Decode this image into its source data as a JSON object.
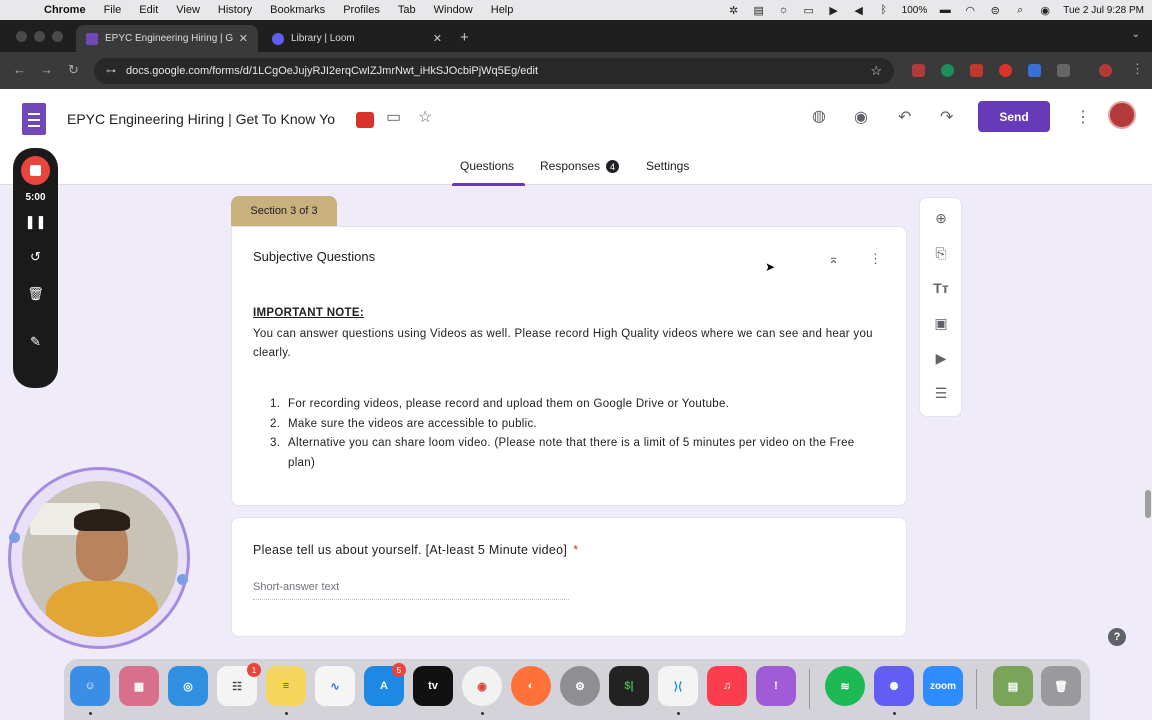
{
  "menubar": {
    "app_name": "Chrome",
    "items": [
      "File",
      "Edit",
      "View",
      "History",
      "Bookmarks",
      "Profiles",
      "Tab",
      "Window",
      "Help"
    ],
    "battery": "100%",
    "datetime": "Tue 2 Jul  9:28 PM"
  },
  "browser": {
    "tabs": [
      {
        "title": "EPYC Engineering Hiring | Ge",
        "active": true
      },
      {
        "title": "Library | Loom",
        "active": false
      }
    ],
    "url": "docs.google.com/forms/d/1LCgOeJujyRJI2erqCwIZJmrNwt_iHkSJOcbiPjWq5Eg/edit"
  },
  "form_header": {
    "title": "EPYC Engineering Hiring | Get To Know Yo",
    "send_label": "Send",
    "tabs": {
      "questions": "Questions",
      "responses": "Responses",
      "responses_count": "4",
      "settings": "Settings"
    }
  },
  "section": {
    "tag": "Section 3 of 3",
    "title": "Subjective Questions",
    "note_heading": "IMPORTANT NOTE:",
    "note_body": "You can answer questions using Videos as well. Please record High Quality videos where we can see and hear you clearly.",
    "list": [
      {
        "num": "1.",
        "text": "For recording videos, please record and upload them on Google Drive or Youtube."
      },
      {
        "num": "2.",
        "text": "Make sure the videos are accessible to public."
      },
      {
        "num": "3.",
        "text": "Alternative you can share loom video. (Please note that there is a limit of 5 minutes per video on the Free plan)"
      }
    ]
  },
  "question": {
    "title": "Please tell us about yourself. [At-least 5 Minute video]",
    "required_mark": "*",
    "placeholder": "Short-answer text"
  },
  "loom": {
    "timer": "5:00"
  },
  "dock": {
    "notif_reminders": "1",
    "notif_appstore": "5",
    "zoom_label": "zoom",
    "tv_label": "tv"
  },
  "colors": {
    "accent": "#673ab7",
    "section_tag": "#c8b17c",
    "required": "#d93025",
    "record": "#e8453c"
  }
}
